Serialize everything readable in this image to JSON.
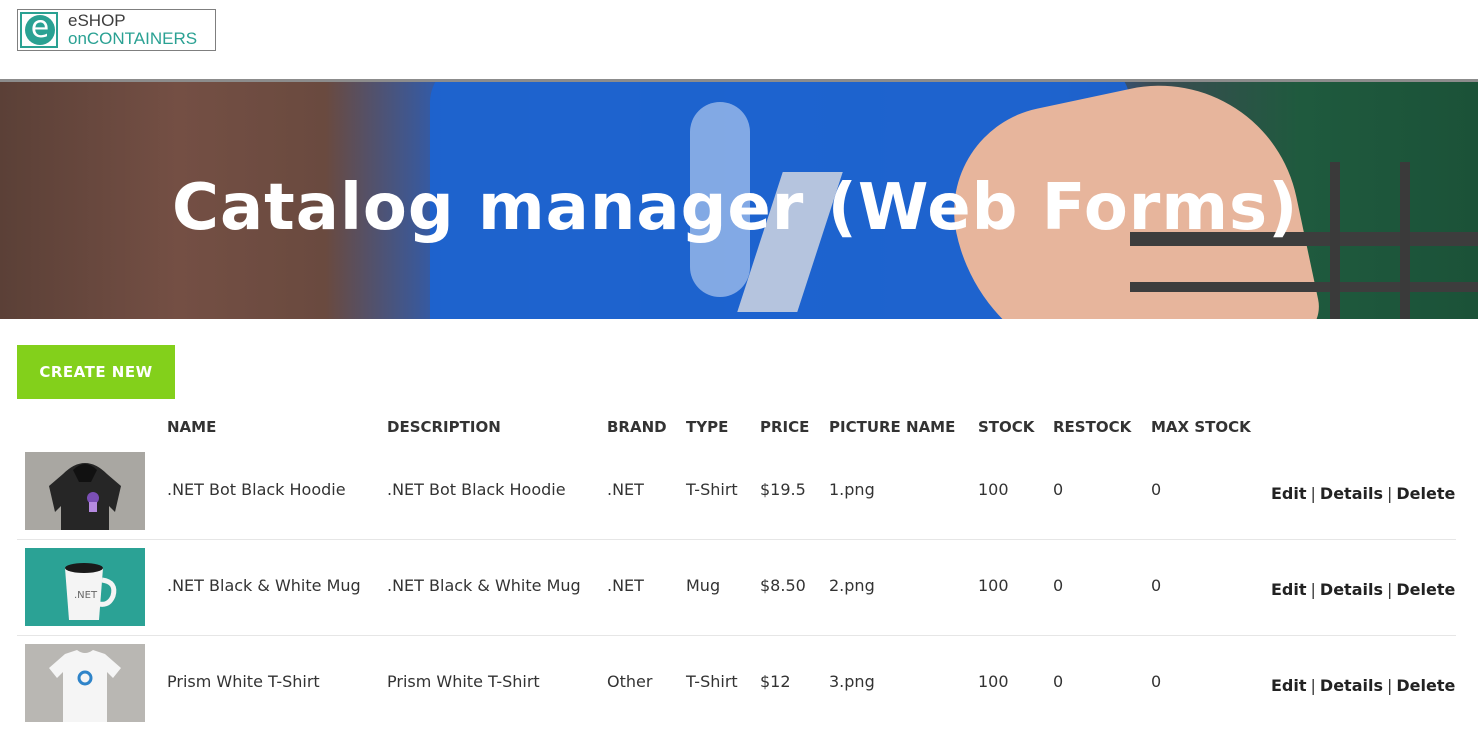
{
  "brand": {
    "line1": "eSHOP",
    "line2": "onCONTAINERS",
    "mark": "e"
  },
  "hero": {
    "title": "Catalog manager (Web Forms)"
  },
  "create_button": "CREATE NEW",
  "columns": [
    "NAME",
    "DESCRIPTION",
    "BRAND",
    "TYPE",
    "PRICE",
    "PICTURE NAME",
    "STOCK",
    "RESTOCK",
    "MAX STOCK"
  ],
  "items": [
    {
      "name": ".NET Bot Black Hoodie",
      "description": ".NET Bot Black Hoodie",
      "brand": ".NET",
      "type": "T-Shirt",
      "price": "$19.5",
      "picture": "1.png",
      "stock": "100",
      "restock": "0",
      "max_stock": "0"
    },
    {
      "name": ".NET Black & White Mug",
      "description": ".NET Black & White Mug",
      "brand": ".NET",
      "type": "Mug",
      "price": "$8.50",
      "picture": "2.png",
      "stock": "100",
      "restock": "0",
      "max_stock": "0"
    },
    {
      "name": "Prism White T-Shirt",
      "description": "Prism White T-Shirt",
      "brand": "Other",
      "type": "T-Shirt",
      "price": "$12",
      "picture": "3.png",
      "stock": "100",
      "restock": "0",
      "max_stock": "0"
    }
  ],
  "actions": {
    "edit": "Edit",
    "details": "Details",
    "delete": "Delete",
    "separator": "|"
  },
  "colors": {
    "brand_teal": "#2aa193",
    "create_green": "#83d01b",
    "hero_blue": "#1e63cf"
  }
}
